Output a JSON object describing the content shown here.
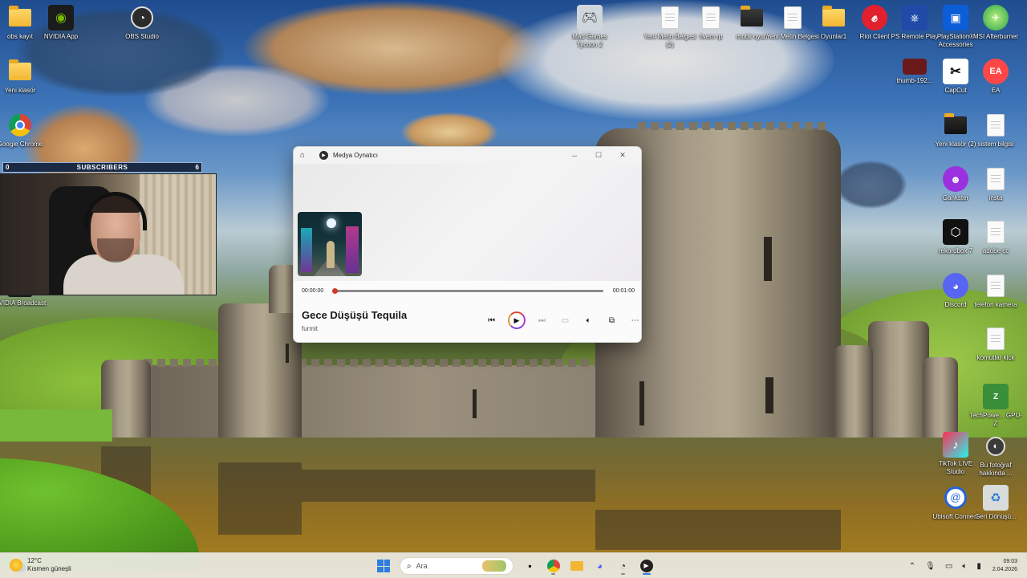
{
  "desktop": {
    "icons": [
      {
        "label": "obs kayıt",
        "icon": "folder-icon"
      },
      {
        "label": "NVIDIA App",
        "icon": "nvidia-icon"
      },
      {
        "label": "OBS Studio",
        "icon": "obs-icon"
      },
      {
        "label": "Mad Games Tycoon 2",
        "icon": "gamepad-icon"
      },
      {
        "label": "Yeni Metin Belgesi (2)",
        "icon": "text-document-icon"
      },
      {
        "label": "fivem rp",
        "icon": "text-document-icon"
      },
      {
        "label": "mobil oyun",
        "icon": "folder-icon"
      },
      {
        "label": "Yeni Metin Belgesi",
        "icon": "text-document-icon"
      },
      {
        "label": "Oyunlar1",
        "icon": "folder-icon"
      },
      {
        "label": "Riot Client",
        "icon": "riot-icon"
      },
      {
        "label": "PS Remote Play",
        "icon": "ps-remote-icon"
      },
      {
        "label": "PlayStation® Accessories",
        "icon": "playstation-icon"
      },
      {
        "label": "MSI Afterburner",
        "icon": "afterburner-icon"
      },
      {
        "label": "Yeni klasör",
        "icon": "folder-icon"
      },
      {
        "label": "thumb-192...",
        "icon": "image-thumbnail-icon"
      },
      {
        "label": "CapCut",
        "icon": "capcut-icon"
      },
      {
        "label": "EA",
        "icon": "ea-icon"
      },
      {
        "label": "Google Chrome",
        "icon": "chrome-icon"
      },
      {
        "label": "Yeni klasör (2)",
        "icon": "folder-icon"
      },
      {
        "label": "sistem bilgisi",
        "icon": "text-document-icon"
      },
      {
        "label": "Gankster",
        "icon": "gankster-icon"
      },
      {
        "label": "insta",
        "icon": "text-document-icon"
      },
      {
        "label": "rekordbox 7",
        "icon": "rekordbox-icon"
      },
      {
        "label": "adobe cc",
        "icon": "text-document-icon"
      },
      {
        "label": "NVIDIA Broadcast",
        "icon": "nvidia-broadcast-icon"
      },
      {
        "label": "Discord",
        "icon": "discord-icon"
      },
      {
        "label": "telefon kamera",
        "icon": "text-document-icon"
      },
      {
        "label": "komutlar kick",
        "icon": "text-document-icon"
      },
      {
        "label": "TechPowe... GPU-Z",
        "icon": "gpuz-icon"
      },
      {
        "label": "TikTok LIVE Studio",
        "icon": "tiktok-icon"
      },
      {
        "label": "Bu fotoğraf hakkında ...",
        "icon": "camera-info-icon"
      },
      {
        "label": "Ubisoft Connect",
        "icon": "ubisoft-icon"
      },
      {
        "label": "Geri Dönüşü...",
        "icon": "recycle-bin-icon"
      }
    ]
  },
  "overlay": {
    "subscribers_label": "SUBSCRIBERS",
    "left_count": "0",
    "right_count": "6"
  },
  "player": {
    "app_title": "Medya Oynatıcı",
    "time_current": "00:00:00",
    "time_total": "00:01:00",
    "progress": 0,
    "song_title": "Gece Düşüşü Tequila",
    "artist": "furmit",
    "controls": [
      "previous-icon",
      "play-icon",
      "next-icon",
      "subtitles-icon",
      "volume-icon",
      "miniplayer-icon",
      "more-icon"
    ],
    "accent": "#d33a2c"
  },
  "taskbar": {
    "weather_temp": "12°C",
    "weather_desc": "Kısmen güneşli",
    "search_placeholder": "Ara",
    "time": "09:03",
    "date": "2.04.2026"
  }
}
